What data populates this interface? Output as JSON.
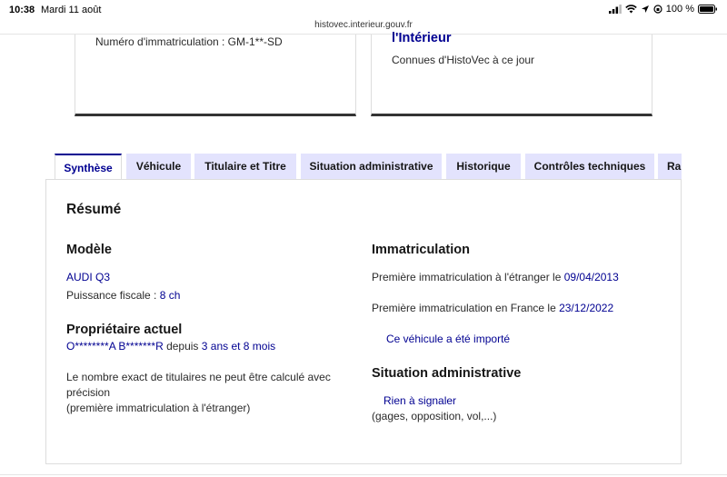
{
  "status_bar": {
    "time": "10:38",
    "date": "Mardi 11 août",
    "battery": "100 %"
  },
  "browser": {
    "url": "histovec.interieur.gouv.fr"
  },
  "cards": {
    "plate_line": "Numéro d'immatriculation : GM-1**-SD",
    "ministry_title": "l'Intérieur",
    "ministry_sub": "Connues d'HistoVec à ce jour"
  },
  "tabs": [
    "Synthèse",
    "Véhicule",
    "Titulaire et Titre",
    "Situation administrative",
    "Historique",
    "Contrôles techniques",
    "Rap"
  ],
  "summary": {
    "title": "Résumé",
    "modele": {
      "heading": "Modèle",
      "vehicle": "AUDI Q3",
      "power_label": "Puissance fiscale : ",
      "power_value": "8 ch"
    },
    "proprietaire": {
      "heading": "Propriétaire actuel",
      "name": "O********A B*******R",
      "since_label": " depuis ",
      "since_value": "3 ans et 8 mois",
      "note_line1": "Le nombre exact de titulaires ne peut être calculé avec",
      "note_line2": "précision",
      "note_line3": "(première immatriculation à l'étranger)"
    },
    "immatriculation": {
      "heading": "Immatriculation",
      "foreign_label": "Première immatriculation à l'étranger le ",
      "foreign_date": "09/04/2013",
      "france_label": "Première immatriculation en France le ",
      "france_date": "23/12/2022",
      "imported": "Ce véhicule a été importé"
    },
    "situation": {
      "heading": "Situation administrative",
      "status": "Rien à signaler",
      "detail": "(gages, opposition, vol,...)"
    }
  }
}
